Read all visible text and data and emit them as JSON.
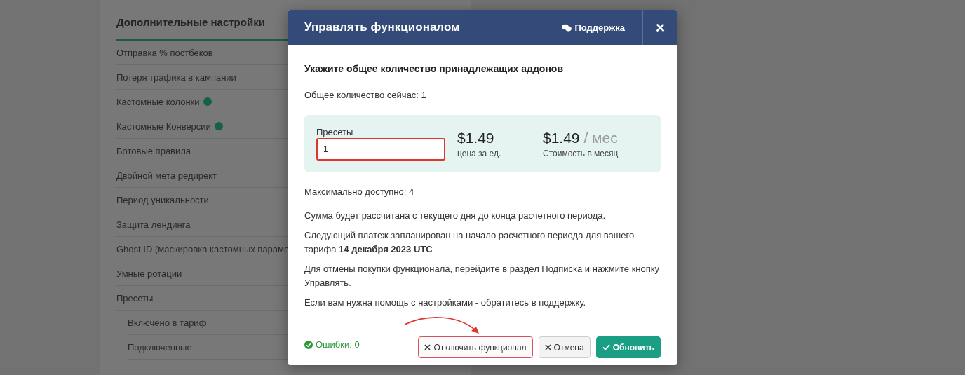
{
  "sidebar": {
    "title": "Дополнительные настройки",
    "items": [
      {
        "label": "Отправка % постбеков",
        "help": false
      },
      {
        "label": "Потеря трафика в кампании",
        "help": false
      },
      {
        "label": "Кастомные колонки",
        "help": true
      },
      {
        "label": "Кастомные Конверсии",
        "help": true
      },
      {
        "label": "Ботовые правила",
        "help": false
      },
      {
        "label": "Двойной мета редирект",
        "help": false
      },
      {
        "label": "Период уникальности",
        "help": false
      },
      {
        "label": "Защита лендинга",
        "help": false
      },
      {
        "label": "Ghost ID (маскировка кастомных параме",
        "help": false
      },
      {
        "label": "Умные ротации",
        "help": false
      },
      {
        "label": "Пресеты",
        "help": false,
        "children": [
          {
            "label": "Включено в тариф",
            "help": false
          },
          {
            "label": "Подключенные",
            "help": false
          }
        ]
      }
    ]
  },
  "modal": {
    "title": "Управлять функционалом",
    "support_link": "Поддержка",
    "heading": "Укажите общее количество принадлежащих аддонов",
    "current_total": "Общее количество сейчас: 1",
    "quantity": {
      "label": "Пресеты",
      "value": "1"
    },
    "unit_price": {
      "amount": "$1.49",
      "caption": "цена за ед."
    },
    "monthly": {
      "amount": "$1.49",
      "period": "/ мес",
      "caption": "Стоимость в месяц"
    },
    "max_available": "Максимально доступно: 4",
    "notes": [
      "Сумма будет рассчитана с текущего дня до конца расчетного периода.",
      "Следующий платеж запланирован на начало расчетного периода для вашего тарифа **14 декабря 2023 UTC**",
      "Для отмены покупки функционала, перейдите в раздел Подписка и нажмите кнопку Управлять.",
      "Если вам нужна помощь с настройками - обратитесь в поддержку."
    ],
    "errors": "Ошибки: 0",
    "buttons": [
      {
        "label": "Отключить функционал",
        "kind": "danger"
      },
      {
        "label": "Отмена",
        "kind": "cancel"
      },
      {
        "label": "Обновить",
        "kind": "primary"
      }
    ]
  }
}
